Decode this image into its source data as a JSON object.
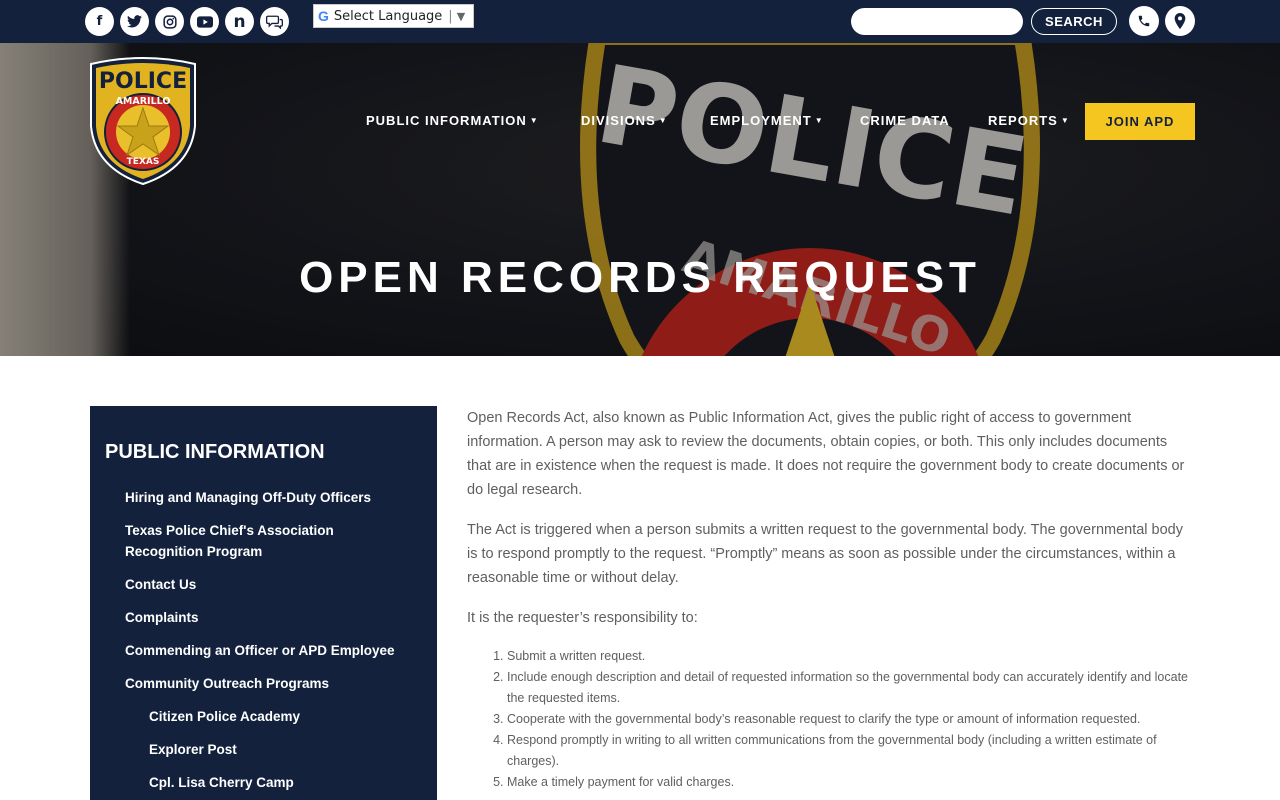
{
  "topbar": {
    "social": [
      {
        "icon": "facebook-icon",
        "glyph": "f"
      },
      {
        "icon": "twitter-icon",
        "glyph": "🐦"
      },
      {
        "icon": "instagram-icon",
        "glyph": "◎"
      },
      {
        "icon": "youtube-icon",
        "glyph": "▶"
      },
      {
        "icon": "nextdoor-icon",
        "glyph": "n"
      },
      {
        "icon": "chat-icon",
        "glyph": "💬"
      }
    ],
    "language_label": "Select Language",
    "search_placeholder": "",
    "search_label": "SEARCH",
    "phone_icon": "phone-icon",
    "location_icon": "map-marker-icon"
  },
  "hero": {
    "patch_text": "POLICE",
    "patch_sub": "AMARILLO",
    "title": "OPEN RECORDS REQUEST"
  },
  "logo": {
    "top": "POLICE",
    "middle": "AMARILLO",
    "bottom": "TEXAS"
  },
  "nav": {
    "items": [
      {
        "label": "PUBLIC INFORMATION",
        "dropdown": true
      },
      {
        "label": "DIVISIONS",
        "dropdown": true
      },
      {
        "label": "EMPLOYMENT",
        "dropdown": true
      },
      {
        "label": "CRIME DATA",
        "dropdown": false
      },
      {
        "label": "REPORTS",
        "dropdown": true
      }
    ],
    "cta": "JOIN APD",
    "cta_color": "#f4c61f"
  },
  "sidebar": {
    "title": "PUBLIC INFORMATION",
    "links": [
      "Hiring and Managing Off-Duty Officers",
      "Texas Police Chief's Association Recognition Program",
      "Contact Us",
      "Complaints",
      "Commending an Officer or APD Employee",
      "Community Outreach Programs",
      "Citizen Police Academy",
      "Explorer Post",
      "Cpl. Lisa Cherry Camp"
    ]
  },
  "content": {
    "paragraphs": [
      "Open Records Act, also known as Public Information Act, gives the public right of access to government information. A person may ask to review the documents, obtain copies, or both. This only includes documents that are in existence when the request is made. It does not require the government body to create documents or do legal research.",
      "The Act is triggered when a person submits a written request to the governmental body. The governmental body is to respond promptly to the request. “Promptly” means as soon as possible under the circumstances, within a reasonable time or without delay.",
      "It is the requester’s responsibility to:"
    ],
    "list": [
      "Submit a written request.",
      "Include enough description and detail of requested information so the governmental body can accurately identify and locate the requested items.",
      "Cooperate with the governmental body’s reasonable request to clarify the type or amount of information requested.",
      "Respond promptly in writing to all written communications from the governmental body (including a written estimate of charges).",
      "Make a timely payment for valid charges."
    ]
  },
  "colors": {
    "navy": "#13213d",
    "gold": "#f4c61f",
    "text": "#5f5f5f"
  }
}
